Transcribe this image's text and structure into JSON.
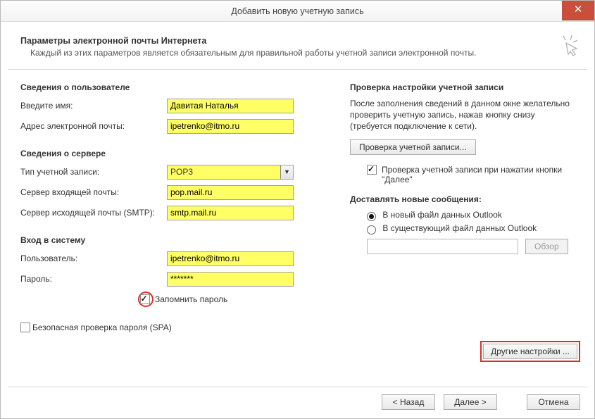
{
  "window": {
    "title": "Добавить новую учетную запись"
  },
  "header": {
    "title": "Параметры электронной почты Интернета",
    "subtitle": "Каждый из этих параметров является обязательным для правильной работы учетной записи электронной почты."
  },
  "left": {
    "user_section": "Сведения о пользователе",
    "name_label": "Введите имя:",
    "name_value": "Давитая Наталья",
    "email_label": "Адрес электронной почты:",
    "email_value": "ipetrenko@itmo.ru",
    "server_section": "Сведения о сервере",
    "acct_type_label": "Тип учетной записи:",
    "acct_type_value": "POP3",
    "in_server_label": "Сервер входящей почты:",
    "in_server_value": "pop.mail.ru",
    "out_server_label": "Сервер исходящей почты (SMTP):",
    "out_server_value": "smtp.mail.ru",
    "login_section": "Вход в систему",
    "user_label": "Пользователь:",
    "user_value": "ipetrenko@itmo.ru",
    "pass_label": "Пароль:",
    "pass_value": "*******",
    "remember_label": "Запомнить пароль",
    "spa_label": "Безопасная проверка пароля (SPA)"
  },
  "right": {
    "test_section": "Проверка настройки учетной записи",
    "test_text": "После заполнения сведений в данном окне желательно проверить учетную запись, нажав кнопку снизу (требуется подключение к сети).",
    "test_btn": "Проверка учетной записи...",
    "check_next_label": "Проверка учетной записи при нажатии кнопки \"Далее\"",
    "deliver_section": "Доставлять новые сообщения:",
    "radio_new": "В новый файл данных Outlook",
    "radio_existing": "В существующий файл данных Outlook",
    "browse_btn": "Обзор",
    "other_btn": "Другие настройки ..."
  },
  "footer": {
    "back": "< Назад",
    "next": "Далее >",
    "cancel": "Отмена"
  }
}
